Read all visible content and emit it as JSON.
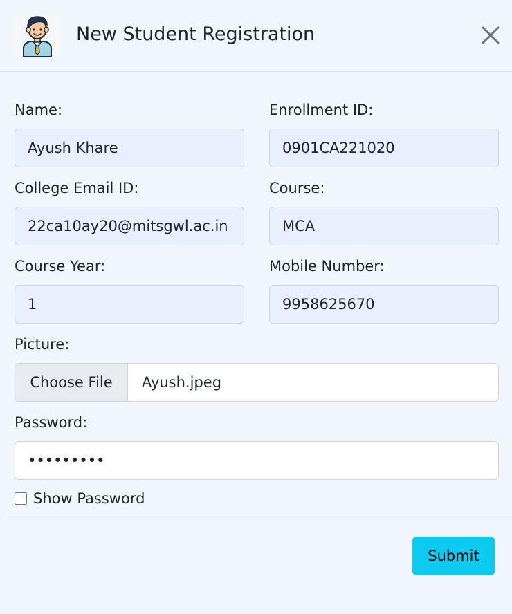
{
  "header": {
    "title": "New Student Registration",
    "avatar_icon": "student-avatar-icon",
    "close_icon": "close-icon"
  },
  "form": {
    "name_label": "Name:",
    "name_value": "Ayush Khare",
    "enrollment_label": "Enrollment ID:",
    "enrollment_value": "0901CA221020",
    "email_label": "College Email ID:",
    "email_value": "22ca10ay20@mitsgwl.ac.in",
    "course_label": "Course:",
    "course_value": "MCA",
    "year_label": "Course Year:",
    "year_value": "1",
    "mobile_label": "Mobile Number:",
    "mobile_value": "9958625670",
    "picture_label": "Picture:",
    "choose_file_label": "Choose File",
    "file_name": "Ayush.jpeg",
    "password_label": "Password:",
    "password_value": "secretpwd",
    "show_password_label": "Show Password",
    "show_password_checked": false
  },
  "footer": {
    "submit_label": "Submit"
  },
  "colors": {
    "background": "#f1f6fc",
    "autofill": "#e8f0fe",
    "submit": "#0dcaf0"
  }
}
